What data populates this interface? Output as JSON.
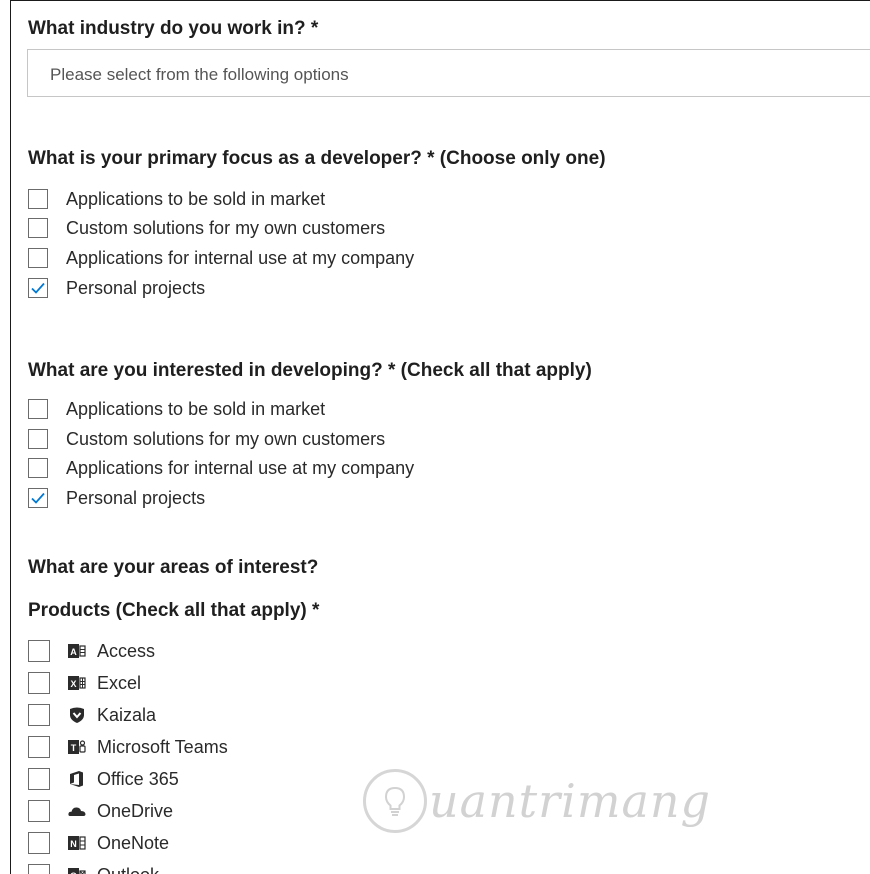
{
  "q1": {
    "label": "What industry do you work in? *",
    "placeholder": "Please select from the following options"
  },
  "q2": {
    "label": "What is your primary focus as a developer? * (Choose only one)",
    "options": [
      {
        "label": "Applications to be sold in market",
        "checked": false
      },
      {
        "label": "Custom solutions for my own customers",
        "checked": false
      },
      {
        "label": "Applications for internal use at my company",
        "checked": false
      },
      {
        "label": "Personal projects",
        "checked": true
      }
    ]
  },
  "q3": {
    "label": "What are you interested in developing? * (Check all that apply)",
    "options": [
      {
        "label": "Applications to be sold in market",
        "checked": false
      },
      {
        "label": "Custom solutions for my own customers",
        "checked": false
      },
      {
        "label": "Applications for internal use at my company",
        "checked": false
      },
      {
        "label": "Personal projects",
        "checked": true
      }
    ]
  },
  "areas": {
    "heading": "What are your areas of interest?"
  },
  "products": {
    "label": "Products (Check all that apply) *",
    "items": [
      {
        "name": "Access",
        "icon": "access-icon",
        "checked": false
      },
      {
        "name": "Excel",
        "icon": "excel-icon",
        "checked": false
      },
      {
        "name": "Kaizala",
        "icon": "kaizala-icon",
        "checked": false
      },
      {
        "name": "Microsoft Teams",
        "icon": "teams-icon",
        "checked": false
      },
      {
        "name": "Office 365",
        "icon": "office-icon",
        "checked": false
      },
      {
        "name": "OneDrive",
        "icon": "onedrive-icon",
        "checked": false
      },
      {
        "name": "OneNote",
        "icon": "onenote-icon",
        "checked": false
      },
      {
        "name": "Outlook",
        "icon": "outlook-icon",
        "checked": false
      }
    ]
  },
  "colors": {
    "check": "#0078d4",
    "product_icon": "#2b2b2b",
    "watermark": "#d2d2d2"
  },
  "watermark": {
    "text": "uantrimang",
    "icon": "lightbulb-icon"
  }
}
